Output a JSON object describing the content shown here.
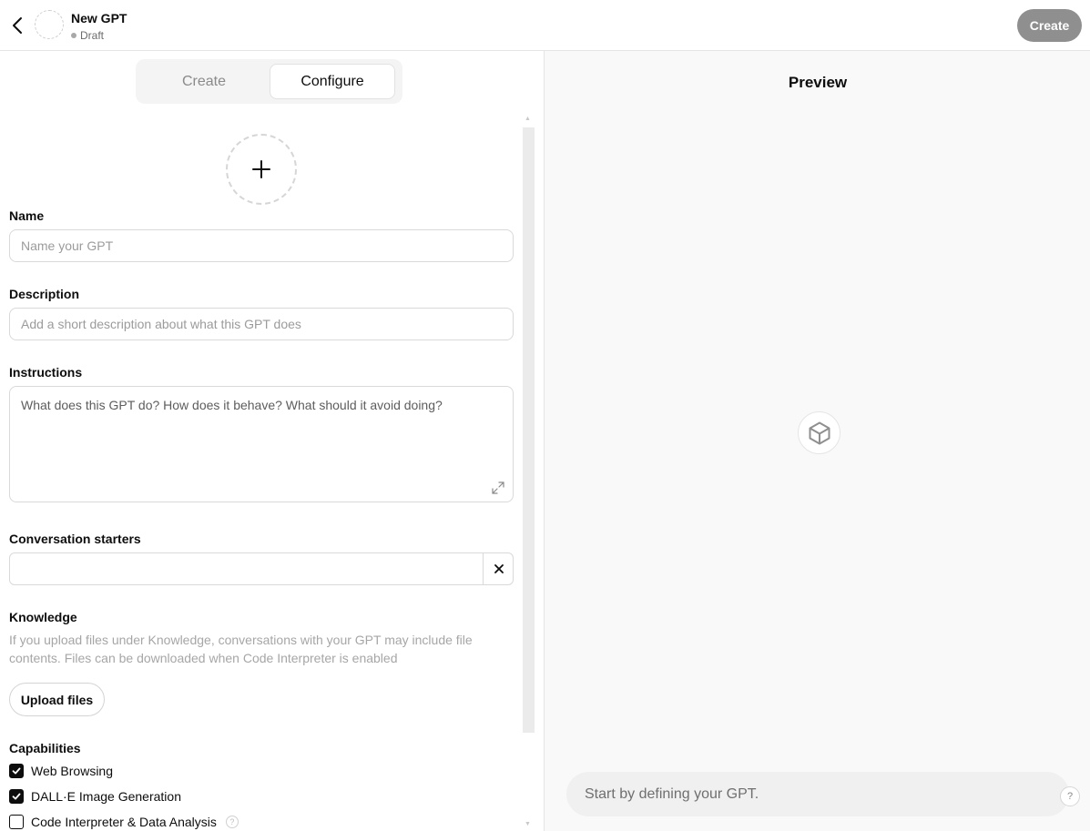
{
  "header": {
    "title": "New GPT",
    "status": "Draft",
    "create_label": "Create"
  },
  "tabs": [
    {
      "label": "Create",
      "active": false
    },
    {
      "label": "Configure",
      "active": true
    }
  ],
  "form": {
    "name": {
      "label": "Name",
      "placeholder": "Name your GPT",
      "value": ""
    },
    "description": {
      "label": "Description",
      "placeholder": "Add a short description about what this GPT does",
      "value": ""
    },
    "instructions": {
      "label": "Instructions",
      "placeholder": "What does this GPT do? How does it behave? What should it avoid doing?",
      "value": ""
    },
    "starters": {
      "label": "Conversation starters",
      "value": ""
    },
    "knowledge": {
      "label": "Knowledge",
      "help": "If you upload files under Knowledge, conversations with your GPT may include file contents. Files can be downloaded when Code Interpreter is enabled",
      "upload_label": "Upload files"
    },
    "capabilities": {
      "label": "Capabilities",
      "items": [
        {
          "label": "Web Browsing",
          "checked": true
        },
        {
          "label": "DALL·E Image Generation",
          "checked": true
        },
        {
          "label": "Code Interpreter & Data Analysis",
          "checked": false,
          "help": "?"
        }
      ]
    }
  },
  "preview": {
    "title": "Preview",
    "input_placeholder": "Start by defining your GPT.",
    "help_label": "?"
  }
}
